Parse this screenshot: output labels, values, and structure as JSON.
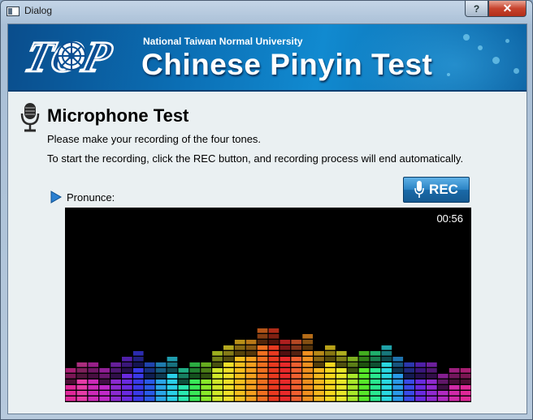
{
  "window": {
    "title": "Dialog",
    "help_label": "?",
    "close_label": "✕"
  },
  "banner": {
    "logo_text": "TOP",
    "university": "National Taiwan Normal University",
    "product": "Chinese Pinyin Test"
  },
  "main": {
    "heading": "Microphone Test",
    "instruction_1": "Please make your recording of the four tones.",
    "instruction_2": "To start the recording, click the REC button, and recording process will end automatically.",
    "pronounce_label": "Pronunce:",
    "rec_label": "REC",
    "timer": "00:56"
  },
  "visualizer": {
    "levels": [
      6,
      7,
      7,
      6,
      7,
      8,
      9,
      7,
      7,
      8,
      6,
      7,
      7,
      9,
      10,
      11,
      11,
      13,
      13,
      11,
      11,
      12,
      9,
      10,
      9,
      8,
      9,
      9,
      10,
      8,
      7,
      7,
      7,
      5,
      6,
      6
    ],
    "colors": [
      "#e0289a",
      "#e63ca8",
      "#cc2ab8",
      "#c02ac8",
      "#8a2ad0",
      "#6a2ae0",
      "#3a3ae8",
      "#2a5ae8",
      "#2aa6e8",
      "#2ad0e8",
      "#2ae8b0",
      "#3ae858",
      "#8ae82a",
      "#d0e82a",
      "#f0e02a",
      "#f5c020",
      "#f5a020",
      "#f07020",
      "#e83a20",
      "#e82a2a",
      "#f06030",
      "#f09020",
      "#f5b820",
      "#f5d820",
      "#e8e82a",
      "#a8e82a",
      "#58e82a",
      "#2ae890",
      "#2ad8e0",
      "#2a9ae8",
      "#3a4ae8",
      "#6a2ae0",
      "#902ad0",
      "#b02ac0",
      "#d02aa8",
      "#e02898"
    ]
  }
}
